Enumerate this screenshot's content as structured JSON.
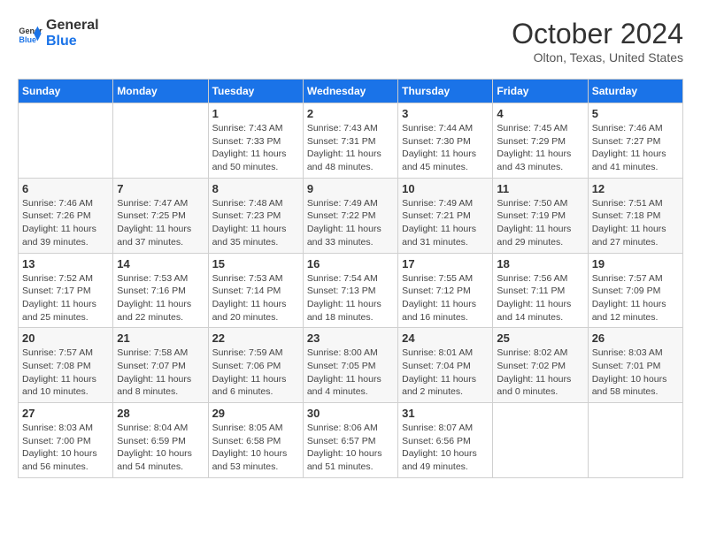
{
  "logo": {
    "line1": "General",
    "line2": "Blue"
  },
  "title": "October 2024",
  "location": "Olton, Texas, United States",
  "days_of_week": [
    "Sunday",
    "Monday",
    "Tuesday",
    "Wednesday",
    "Thursday",
    "Friday",
    "Saturday"
  ],
  "weeks": [
    [
      {
        "day": "",
        "info": ""
      },
      {
        "day": "",
        "info": ""
      },
      {
        "day": "1",
        "info": "Sunrise: 7:43 AM\nSunset: 7:33 PM\nDaylight: 11 hours and 50 minutes."
      },
      {
        "day": "2",
        "info": "Sunrise: 7:43 AM\nSunset: 7:31 PM\nDaylight: 11 hours and 48 minutes."
      },
      {
        "day": "3",
        "info": "Sunrise: 7:44 AM\nSunset: 7:30 PM\nDaylight: 11 hours and 45 minutes."
      },
      {
        "day": "4",
        "info": "Sunrise: 7:45 AM\nSunset: 7:29 PM\nDaylight: 11 hours and 43 minutes."
      },
      {
        "day": "5",
        "info": "Sunrise: 7:46 AM\nSunset: 7:27 PM\nDaylight: 11 hours and 41 minutes."
      }
    ],
    [
      {
        "day": "6",
        "info": "Sunrise: 7:46 AM\nSunset: 7:26 PM\nDaylight: 11 hours and 39 minutes."
      },
      {
        "day": "7",
        "info": "Sunrise: 7:47 AM\nSunset: 7:25 PM\nDaylight: 11 hours and 37 minutes."
      },
      {
        "day": "8",
        "info": "Sunrise: 7:48 AM\nSunset: 7:23 PM\nDaylight: 11 hours and 35 minutes."
      },
      {
        "day": "9",
        "info": "Sunrise: 7:49 AM\nSunset: 7:22 PM\nDaylight: 11 hours and 33 minutes."
      },
      {
        "day": "10",
        "info": "Sunrise: 7:49 AM\nSunset: 7:21 PM\nDaylight: 11 hours and 31 minutes."
      },
      {
        "day": "11",
        "info": "Sunrise: 7:50 AM\nSunset: 7:19 PM\nDaylight: 11 hours and 29 minutes."
      },
      {
        "day": "12",
        "info": "Sunrise: 7:51 AM\nSunset: 7:18 PM\nDaylight: 11 hours and 27 minutes."
      }
    ],
    [
      {
        "day": "13",
        "info": "Sunrise: 7:52 AM\nSunset: 7:17 PM\nDaylight: 11 hours and 25 minutes."
      },
      {
        "day": "14",
        "info": "Sunrise: 7:53 AM\nSunset: 7:16 PM\nDaylight: 11 hours and 22 minutes."
      },
      {
        "day": "15",
        "info": "Sunrise: 7:53 AM\nSunset: 7:14 PM\nDaylight: 11 hours and 20 minutes."
      },
      {
        "day": "16",
        "info": "Sunrise: 7:54 AM\nSunset: 7:13 PM\nDaylight: 11 hours and 18 minutes."
      },
      {
        "day": "17",
        "info": "Sunrise: 7:55 AM\nSunset: 7:12 PM\nDaylight: 11 hours and 16 minutes."
      },
      {
        "day": "18",
        "info": "Sunrise: 7:56 AM\nSunset: 7:11 PM\nDaylight: 11 hours and 14 minutes."
      },
      {
        "day": "19",
        "info": "Sunrise: 7:57 AM\nSunset: 7:09 PM\nDaylight: 11 hours and 12 minutes."
      }
    ],
    [
      {
        "day": "20",
        "info": "Sunrise: 7:57 AM\nSunset: 7:08 PM\nDaylight: 11 hours and 10 minutes."
      },
      {
        "day": "21",
        "info": "Sunrise: 7:58 AM\nSunset: 7:07 PM\nDaylight: 11 hours and 8 minutes."
      },
      {
        "day": "22",
        "info": "Sunrise: 7:59 AM\nSunset: 7:06 PM\nDaylight: 11 hours and 6 minutes."
      },
      {
        "day": "23",
        "info": "Sunrise: 8:00 AM\nSunset: 7:05 PM\nDaylight: 11 hours and 4 minutes."
      },
      {
        "day": "24",
        "info": "Sunrise: 8:01 AM\nSunset: 7:04 PM\nDaylight: 11 hours and 2 minutes."
      },
      {
        "day": "25",
        "info": "Sunrise: 8:02 AM\nSunset: 7:02 PM\nDaylight: 11 hours and 0 minutes."
      },
      {
        "day": "26",
        "info": "Sunrise: 8:03 AM\nSunset: 7:01 PM\nDaylight: 10 hours and 58 minutes."
      }
    ],
    [
      {
        "day": "27",
        "info": "Sunrise: 8:03 AM\nSunset: 7:00 PM\nDaylight: 10 hours and 56 minutes."
      },
      {
        "day": "28",
        "info": "Sunrise: 8:04 AM\nSunset: 6:59 PM\nDaylight: 10 hours and 54 minutes."
      },
      {
        "day": "29",
        "info": "Sunrise: 8:05 AM\nSunset: 6:58 PM\nDaylight: 10 hours and 53 minutes."
      },
      {
        "day": "30",
        "info": "Sunrise: 8:06 AM\nSunset: 6:57 PM\nDaylight: 10 hours and 51 minutes."
      },
      {
        "day": "31",
        "info": "Sunrise: 8:07 AM\nSunset: 6:56 PM\nDaylight: 10 hours and 49 minutes."
      },
      {
        "day": "",
        "info": ""
      },
      {
        "day": "",
        "info": ""
      }
    ]
  ]
}
